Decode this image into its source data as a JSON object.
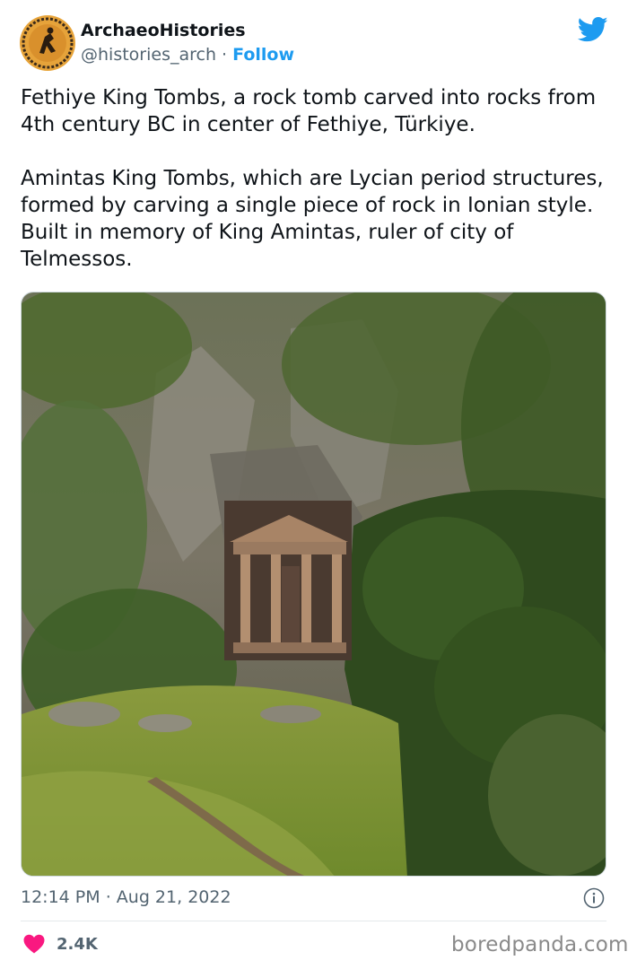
{
  "author": {
    "display_name": "ArchaeoHistories",
    "handle": "@histories_arch",
    "separator": "·",
    "follow_label": "Follow"
  },
  "tweet": {
    "paragraph_1": "Fethiye King Tombs, a rock tomb carved into rocks from 4th century BC in center of Fethiye, Türkiye.",
    "paragraph_2": "Amintas King Tombs, which are Lycian period structures, formed by carving a single piece of rock in Ionian style. Built in memory of King Amintas, ruler of city of Telmessos."
  },
  "meta": {
    "time": "12:14 PM",
    "separator": "·",
    "date": "Aug 21, 2022"
  },
  "stats": {
    "likes": "2.4K"
  },
  "watermark": "boredpanda.com",
  "icons": {
    "platform": "twitter-bird-icon",
    "info": "info-icon",
    "like": "heart-icon"
  },
  "colors": {
    "accent": "#1d9bf0",
    "text_primary": "#0f1419",
    "text_secondary": "#536471",
    "like": "#f91880",
    "avatar": "#e8a53a"
  }
}
